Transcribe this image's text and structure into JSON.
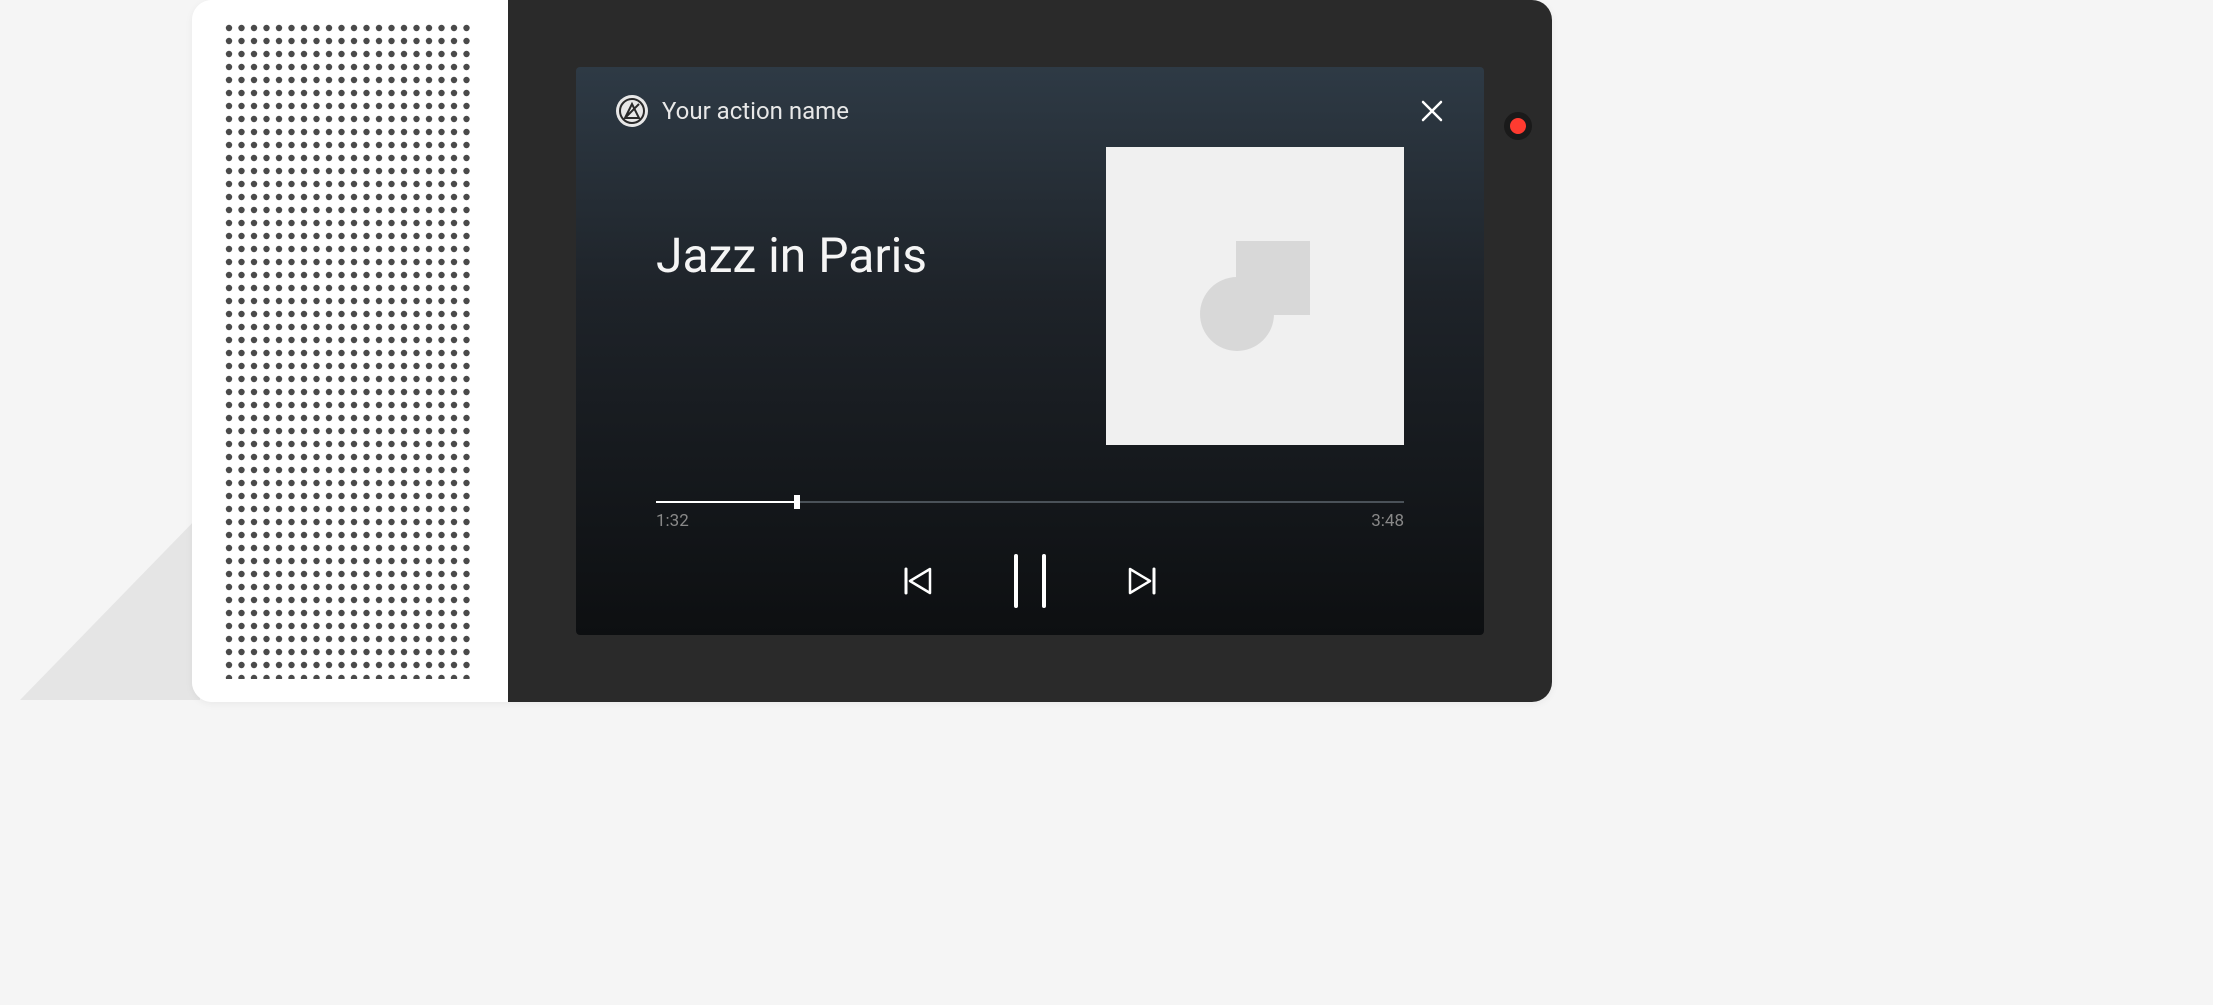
{
  "header": {
    "action_name": "Your action name",
    "icons": {
      "action": "action-logo-icon",
      "close": "close-icon"
    }
  },
  "player": {
    "track_title": "Jazz in Paris",
    "elapsed_time": "1:32",
    "total_time": "3:48",
    "progress_percent": 18.8,
    "state": "playing"
  },
  "controls": {
    "previous": "previous-icon",
    "play_pause": "pause-icon",
    "next": "next-icon"
  },
  "colors": {
    "background_gradient_top": "#2e3a45",
    "background_gradient_bottom": "#0d0f11",
    "text_primary": "#f5f5f5",
    "text_secondary": "#888888",
    "progress_track": "#4a5158",
    "indicator_red": "#ff3b30"
  }
}
